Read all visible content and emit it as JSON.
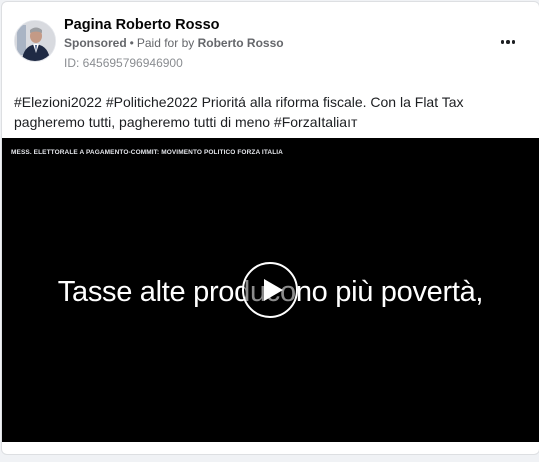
{
  "post": {
    "page_name": "Pagina Roberto Rosso",
    "sponsored_label": "Sponsored",
    "separator": "•",
    "paid_for_by_label": "Paid for by",
    "paid_for_by_name": "Roberto Rosso",
    "ad_id": "ID: 645695796946900",
    "text": "#Elezioni2022 #Politiche2022 Prioritá alla riforma fiscale. Con la Flat Tax pagheremo tutti, pagheremo tutti di meno #ForzaItaliaıт"
  },
  "video": {
    "caption": "MESS. ELETTORALE A PAGAMENTO-COMMIT: MOVIMENTO POLITICO FORZA ITALIA",
    "subtitle": "Tasse alte producono più povertà,"
  },
  "icons": {
    "more": "more-options-icon",
    "play": "play-icon",
    "avatar": "profile-photo"
  },
  "colors": {
    "page_background": "#f0f2f5",
    "card_background": "#ffffff",
    "video_background": "#000000",
    "secondary_text": "#65676b"
  }
}
